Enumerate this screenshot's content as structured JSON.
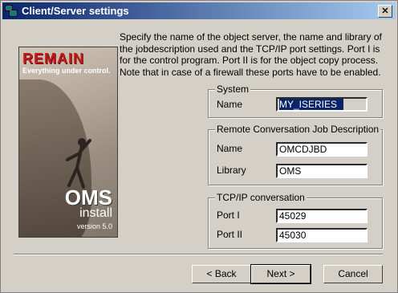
{
  "window": {
    "title": "Client/Server settings",
    "close_glyph": "✕"
  },
  "description": "Specify the name of the object server, the name and library of the jobdescription used and the TCP/IP port settings. Port I is for the control program. Port II is for the object copy process. Note that in case of a firewall these ports have to be enabled.",
  "splash": {
    "brand": "REMAIN",
    "slogan": "Everything under control.",
    "product": "OMS",
    "subtitle": "install",
    "version": "version 5.0"
  },
  "system": {
    "legend": "System",
    "name_label": "Name",
    "name_value": "MY_ISERIES"
  },
  "job_description": {
    "legend": "Remote Conversation Job Description",
    "name_label": "Name",
    "name_value": "OMCDJBD",
    "library_label": "Library",
    "library_value": "OMS"
  },
  "tcpip": {
    "legend": "TCP/IP conversation",
    "port1_label": "Port I",
    "port1_value": "45029",
    "port2_label": "Port II",
    "port2_value": "45030"
  },
  "buttons": {
    "back": "< Back",
    "next": "Next >",
    "cancel": "Cancel"
  }
}
